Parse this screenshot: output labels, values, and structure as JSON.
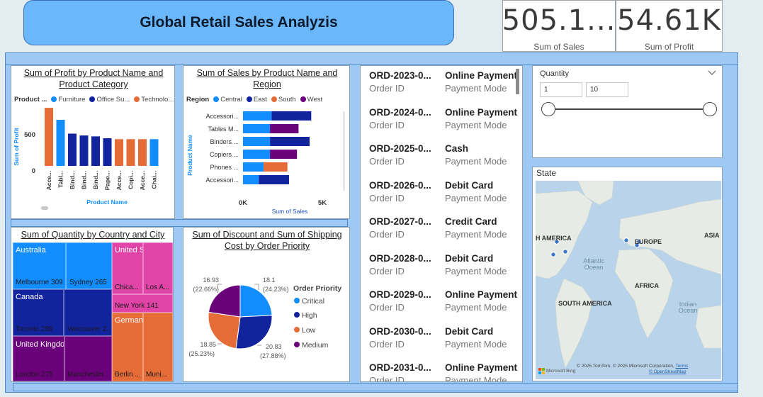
{
  "header": {
    "title": "Global Retail Sales Analyzis"
  },
  "kpis": [
    {
      "value": "505.1...",
      "label": "Sum of Sales"
    },
    {
      "value": "54.61K",
      "label": "Sum of Profit"
    }
  ],
  "profit_chart": {
    "title": "Sum of Profit by Product Name and Product Category",
    "legend_title": "Product ...",
    "legend": [
      "Furniture",
      "Office Su...",
      "Technolo..."
    ],
    "y_label": "Sum of Profit",
    "x_label": "Product Name",
    "y_ticks": [
      "500",
      "0"
    ],
    "colors": {
      "Furniture": "#118dff",
      "Office Supplies": "#12239e",
      "Technology": "#e66c37"
    }
  },
  "sales_chart": {
    "title": "Sum of Sales by Product Name and Region",
    "legend_title": "Region",
    "legend": [
      "Central",
      "East",
      "South",
      "West"
    ],
    "y_label": "Product Name",
    "x_label": "Sum of Sales",
    "x_ticks": [
      "0K",
      "5K"
    ],
    "colors": {
      "Central": "#118dff",
      "East": "#12239e",
      "South": "#e66c37",
      "West": "#6b007b"
    }
  },
  "treemap": {
    "title": "Sum of Quantity by Country and City",
    "countries": [
      "Australia",
      "United States",
      "Canada",
      "Germany",
      "United Kingdom"
    ],
    "cities": [
      "Melbourne 309",
      "Sydney 265",
      "Chica...",
      "Los A...",
      "New York 141",
      "Toronto 289",
      "Vancouver 2...",
      "Berlin ...",
      "Muni...",
      "London 275",
      "Manchester..."
    ]
  },
  "pie_chart": {
    "title": "Sum of Discount and Sum of Shipping Cost by Order Priority",
    "legend_title": "Order Priority",
    "legend": [
      "Critical",
      "High",
      "Low",
      "Medium"
    ],
    "labels": [
      {
        "value": "18.1",
        "pct": "(24.23%)"
      },
      {
        "value": "20.83",
        "pct": "(27.88%)"
      },
      {
        "value": "18.85",
        "pct": "(25.23%)"
      },
      {
        "value": "16.93",
        "pct": "(22.66%)"
      }
    ]
  },
  "orders": {
    "id_label": "Order ID",
    "pm_label": "Payment Mode",
    "items": [
      {
        "id": "ORD-2023-0...",
        "pm": "Online Payment"
      },
      {
        "id": "ORD-2024-0...",
        "pm": "Online Payment"
      },
      {
        "id": "ORD-2025-0...",
        "pm": "Cash"
      },
      {
        "id": "ORD-2026-0...",
        "pm": "Debit Card"
      },
      {
        "id": "ORD-2027-0...",
        "pm": "Credit Card"
      },
      {
        "id": "ORD-2028-0...",
        "pm": "Debit Card"
      },
      {
        "id": "ORD-2029-0...",
        "pm": "Online Payment"
      },
      {
        "id": "ORD-2030-0...",
        "pm": "Debit Card"
      },
      {
        "id": "ORD-2031-0...",
        "pm": "Online Payment"
      }
    ]
  },
  "slicer": {
    "title": "Quantity",
    "min": "1",
    "max": "10"
  },
  "map": {
    "title": "State",
    "labels": [
      "H AMERICA",
      "EUROPE",
      "ASIA",
      "AFRICA",
      "SOUTH AMERICA"
    ],
    "oceans": [
      "Atlantic Ocean",
      "Indian Ocean"
    ],
    "attribution": "© 2025 TomTom, © 2025 Microsoft Corporation,",
    "attribution_osm": "© OpenStreetMap",
    "terms": "Terms",
    "bing": "Microsoft Bing"
  },
  "chart_data": [
    {
      "type": "bar",
      "title": "Sum of Profit by Product Name and Product Category",
      "xlabel": "Product Name",
      "ylabel": "Sum of Profit",
      "categories": [
        "Acce...",
        "Tabl...",
        "Bind...",
        "Bind...",
        "Bind...",
        "Pape...",
        "Acce...",
        "Copi...",
        "Acce...",
        "Chai..."
      ],
      "series": [
        {
          "name": "Technolo...",
          "values": [
            630,
            0,
            0,
            0,
            0,
            0,
            290,
            290,
            290,
            0
          ]
        },
        {
          "name": "Furniture",
          "values": [
            0,
            500,
            0,
            0,
            0,
            0,
            0,
            0,
            0,
            290
          ]
        },
        {
          "name": "Office Su...",
          "values": [
            0,
            0,
            350,
            330,
            320,
            300,
            0,
            0,
            0,
            0
          ]
        }
      ],
      "ylim": [
        0,
        700
      ]
    },
    {
      "type": "bar",
      "title": "Sum of Sales by Product Name and Region",
      "xlabel": "Sum of Sales",
      "ylabel": "Product Name",
      "categories": [
        "Accessori...",
        "Tables M...",
        "Binders ...",
        "Copiers ...",
        "Phones ...",
        "Accessori..."
      ],
      "series": [
        {
          "name": "Central",
          "values": [
            1800,
            1700,
            1700,
            1700,
            1300,
            1000
          ]
        },
        {
          "name": "East",
          "values": [
            2500,
            0,
            2500,
            0,
            0,
            1900
          ]
        },
        {
          "name": "South",
          "values": [
            0,
            0,
            0,
            0,
            1500,
            0
          ]
        },
        {
          "name": "West",
          "values": [
            0,
            1800,
            0,
            1700,
            0,
            0
          ]
        }
      ],
      "xlim": [
        0,
        6500
      ]
    },
    {
      "type": "pie",
      "title": "Sum of Discount and Sum of Shipping Cost by Order Priority",
      "categories": [
        "Critical",
        "High",
        "Low",
        "Medium"
      ],
      "values": [
        18.1,
        20.83,
        18.85,
        16.93
      ]
    },
    {
      "type": "heatmap",
      "title": "Sum of Quantity by Country and City",
      "categories": [
        "Australia",
        "United States",
        "Canada",
        "Germany",
        "United Kingdom"
      ],
      "series": [
        {
          "name": "Australia",
          "values": [
            309,
            265
          ]
        },
        {
          "name": "Canada",
          "values": [
            289
          ]
        },
        {
          "name": "United States",
          "values": [
            141
          ]
        },
        {
          "name": "United Kingdom",
          "values": [
            275
          ]
        }
      ]
    }
  ]
}
